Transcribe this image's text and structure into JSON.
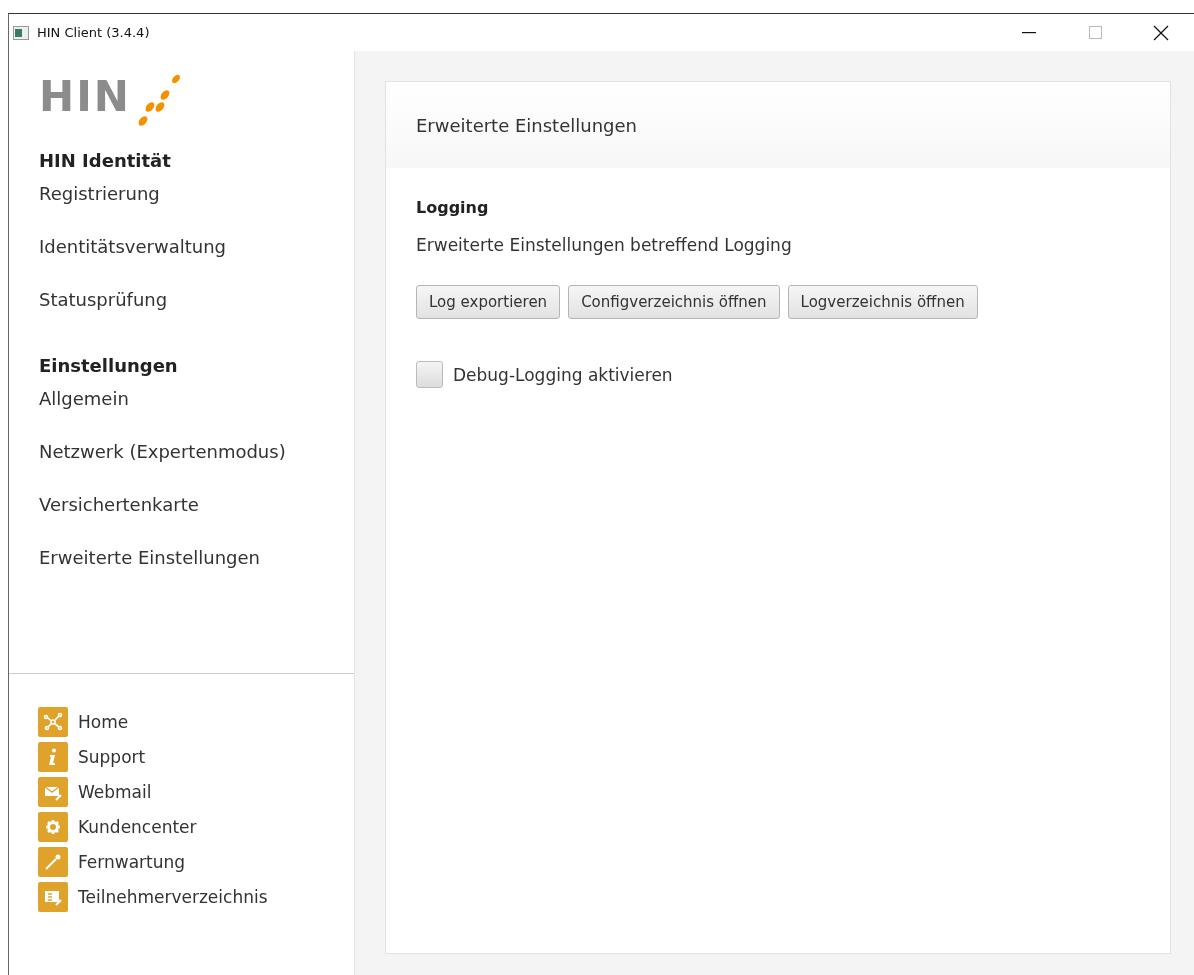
{
  "window": {
    "title": "HIN Client (3.4.4)"
  },
  "logo": {
    "text": "HIN"
  },
  "sidebar": {
    "sections": [
      {
        "heading": "HIN Identität",
        "items": [
          "Registrierung",
          "Identitätsverwaltung",
          "Statusprüfung"
        ]
      },
      {
        "heading": "Einstellungen",
        "items": [
          "Allgemein",
          "Netzwerk (Expertenmodus)",
          "Versichertenkarte",
          "Erweiterte Einstellungen"
        ]
      }
    ],
    "links": [
      {
        "kind": "network",
        "label": "Home"
      },
      {
        "kind": "info",
        "label": "Support"
      },
      {
        "kind": "mail",
        "label": "Webmail"
      },
      {
        "kind": "gear",
        "label": "Kundencenter"
      },
      {
        "kind": "wrench",
        "label": "Fernwartung"
      },
      {
        "kind": "directory",
        "label": "Teilnehmerverzeichnis"
      }
    ]
  },
  "panel": {
    "title": "Erweiterte Einstellungen",
    "section": "Logging",
    "description": "Erweiterte Einstellungen betreffend Logging",
    "buttons": [
      "Log exportieren",
      "Configverzeichnis öffnen",
      "Logverzeichnis öffnen"
    ],
    "checkbox": {
      "label": "Debug-Logging aktivieren",
      "checked": false
    }
  }
}
